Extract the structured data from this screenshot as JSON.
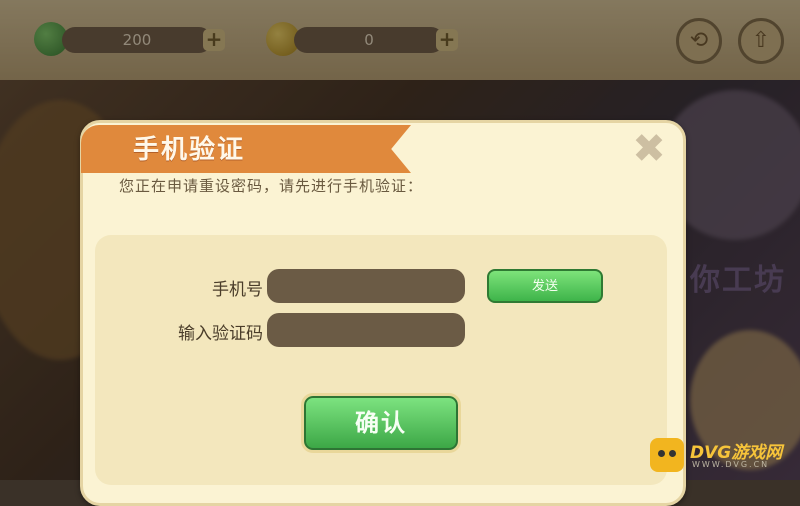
{
  "header": {
    "gems_value": "200",
    "coins_value": "0",
    "plus_label": "+",
    "settings_glyph": "⟲",
    "exit_glyph": "⇧"
  },
  "background": {
    "right_banner_text": "你工坊",
    "left_bottom_text": "..."
  },
  "dialog": {
    "title": "手机验证",
    "close_label": "✖",
    "subtitle": "您正在申请重设密码，请先进行手机验证：",
    "phone_label": "手机号",
    "phone_value": "",
    "send_label": "发送",
    "code_label": "输入验证码",
    "code_value": "",
    "confirm_label": "确认"
  },
  "watermark": {
    "brand": "DVG游戏网",
    "sub": "WWW.DVG.CN"
  },
  "colors": {
    "ribbon": "#e0893c",
    "dialog_bg": "#fbf3d3",
    "panel_bg": "#f3e7bd",
    "input_bg": "#6b5b45",
    "button_green": "#3eb44a"
  }
}
